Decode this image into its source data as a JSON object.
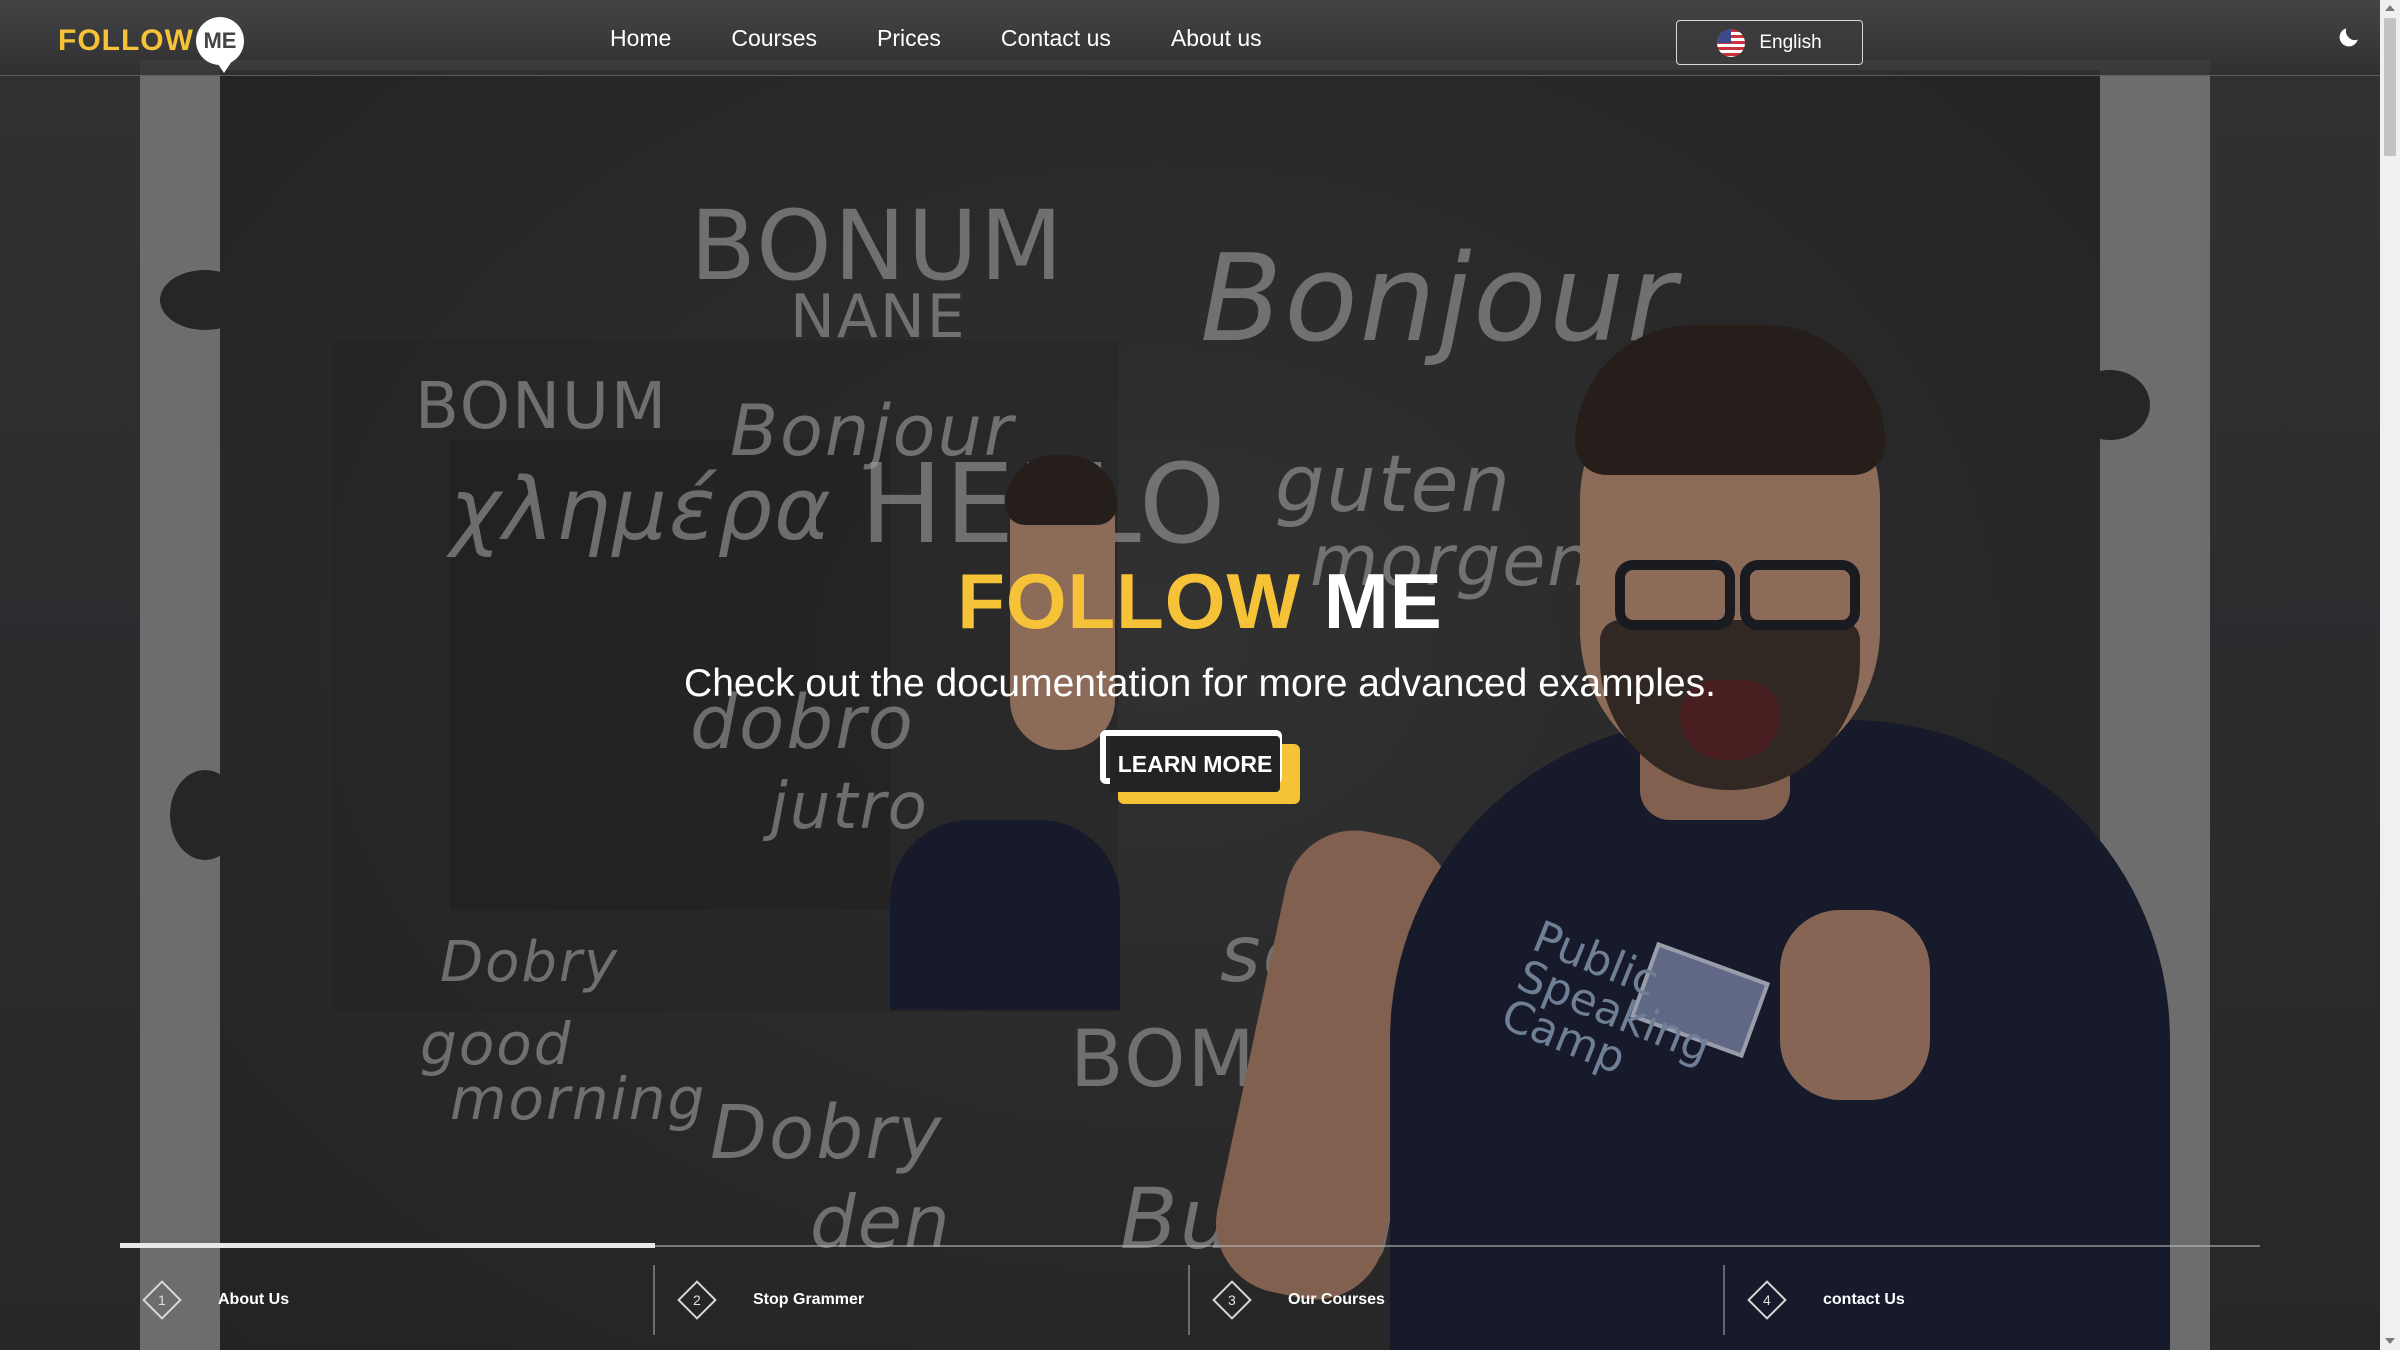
{
  "brand": {
    "logo_main": "FOLLOW",
    "logo_badge": "ME"
  },
  "nav": {
    "items": [
      {
        "label": "Home"
      },
      {
        "label": "Courses"
      },
      {
        "label": "Prices"
      },
      {
        "label": "Contact us"
      },
      {
        "label": "About us"
      }
    ]
  },
  "language": {
    "label": "English",
    "flag_icon": "us-flag-icon"
  },
  "theme_toggle": {
    "icon": "moon-icon"
  },
  "hero": {
    "title_part1": "FOLLOW",
    "title_part2": "ME",
    "subtitle": "Check out the documentation for more advanced examples.",
    "cta_label": "LEARN MORE",
    "chalk_words": [
      "BONUM",
      "NANE",
      "Bonjour",
      "BONUM",
      "Bonjour",
      "χλημέρα",
      "HELLO",
      "guten",
      "morgen",
      "dobro",
      "jutro",
      "Dobry",
      "good",
      "morning",
      "Dobry",
      "den",
      "BOM",
      "Buongi",
      "sol"
    ],
    "shirt_text": "Public Speaking Camp"
  },
  "steps": [
    {
      "number": "1",
      "label": "About Us"
    },
    {
      "number": "2",
      "label": "Stop Grammer"
    },
    {
      "number": "3",
      "label": "Our Courses"
    },
    {
      "number": "4",
      "label": "contact Us"
    }
  ],
  "colors": {
    "accent": "#f5c238",
    "text": "#ffffff",
    "bg": "#2a2a2c"
  }
}
